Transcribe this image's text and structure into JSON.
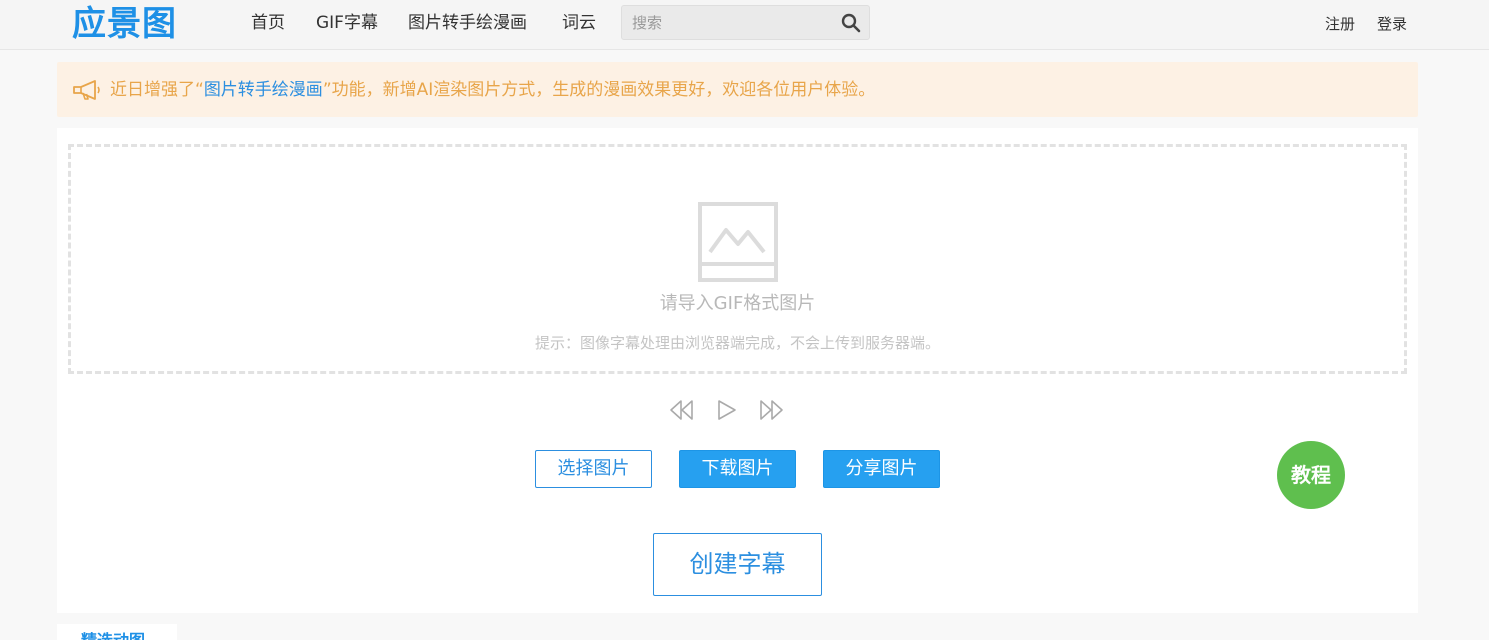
{
  "header": {
    "logo": "应景图",
    "nav": [
      "首页",
      "GIF字幕",
      "图片转手绘漫画",
      "词云"
    ],
    "search": {
      "placeholder": "搜索",
      "value": "",
      "icon": "search-icon"
    },
    "auth": {
      "register": "注册",
      "login": "登录"
    }
  },
  "notice": {
    "icon": "megaphone-icon",
    "prefix": "近日增强了",
    "quote_open": "“",
    "highlight": "图片转手绘漫画",
    "quote_close": "”",
    "suffix": "功能，新增AI渲染图片方式，生成的漫画效果更好，欢迎各位用户体验。"
  },
  "upload": {
    "icon": "image-icon",
    "title": "请导入GIF格式图片",
    "hint": "提示：图像字幕处理由浏览器端完成，不会上传到服务器端。"
  },
  "controls": [
    "rewind-icon",
    "play-icon",
    "fast-forward-icon"
  ],
  "buttons": {
    "select": "选择图片",
    "download": "下载图片",
    "share": "分享图片",
    "create": "创建字幕",
    "tutorial": "教程"
  },
  "bottom_tab": {
    "label": "精选动图"
  },
  "colors": {
    "brand": "#1e90e6",
    "notice_bg": "#fdf1e4",
    "notice_text": "#e8a54a",
    "primary_button": "#26a0f0",
    "tutorial_badge": "#5fbf4e"
  }
}
